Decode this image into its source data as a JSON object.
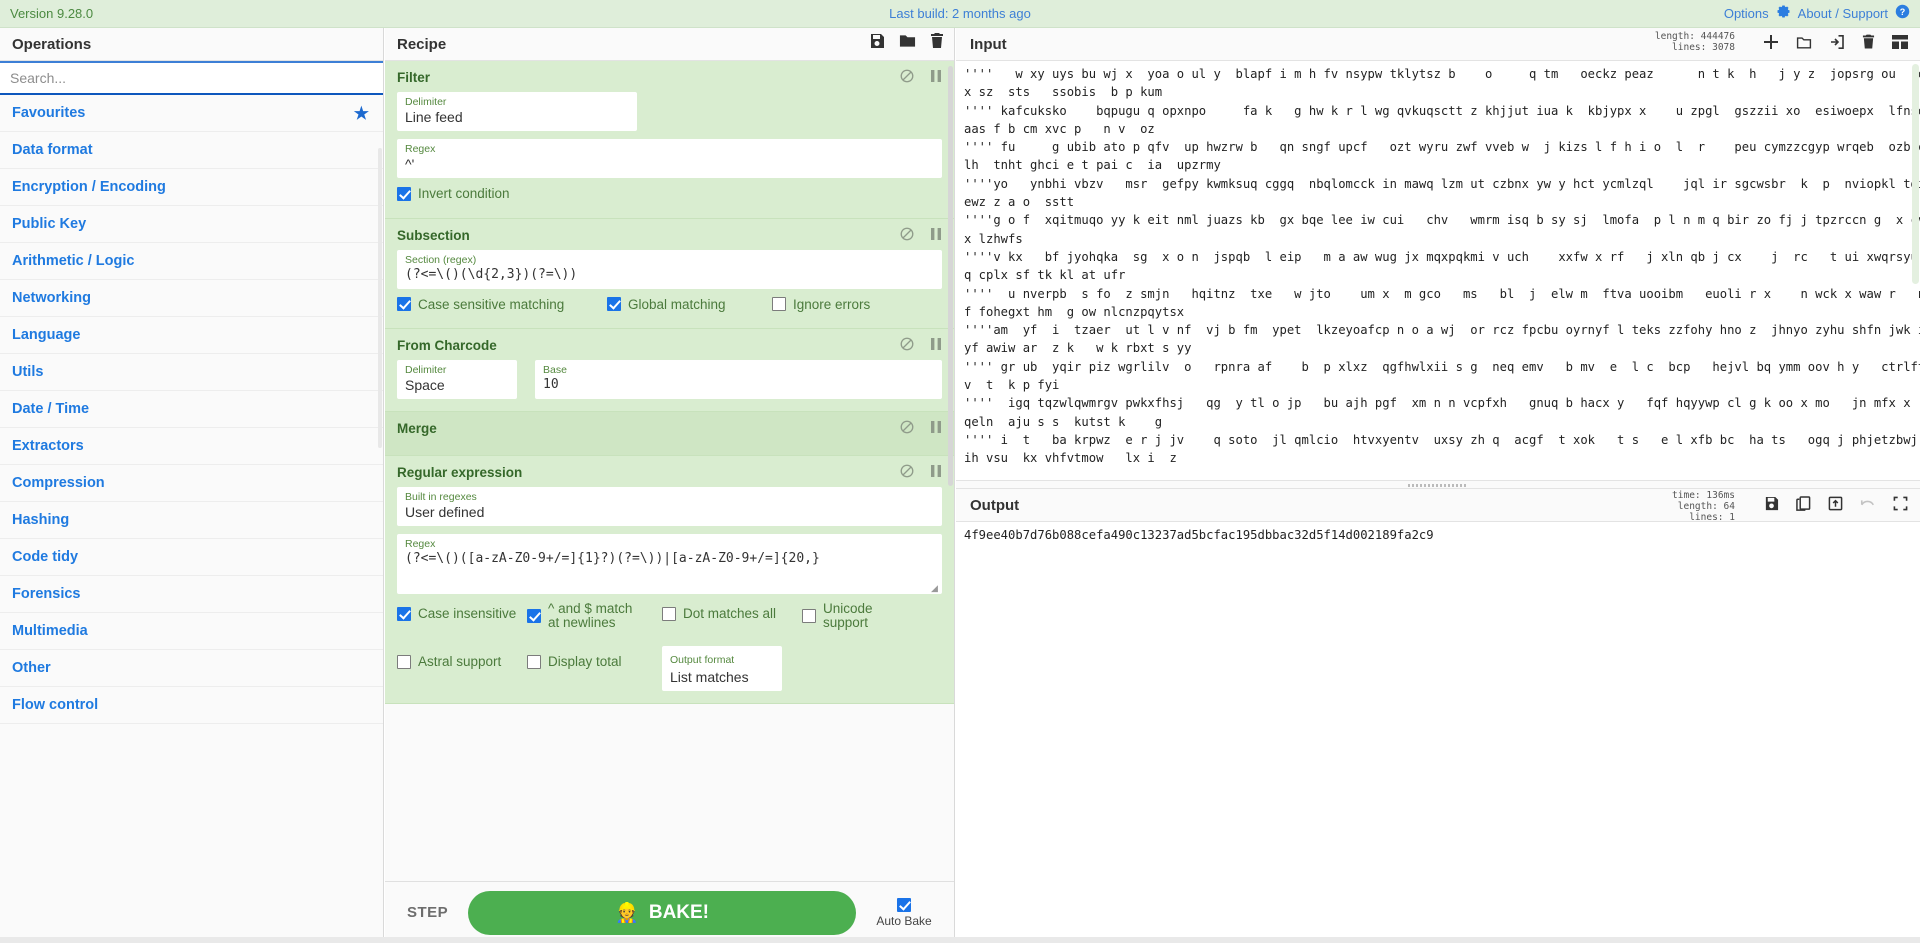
{
  "banner": {
    "version": "Version 9.28.0",
    "last_build": "Last build: 2 months ago",
    "options_label": "Options",
    "about_label": "About / Support",
    "bg_color": "#dfeeda",
    "link_color": "#3d7fd6"
  },
  "operations": {
    "title": "Operations",
    "search_placeholder": "Search...",
    "search_value": "",
    "items": [
      {
        "label": "Favourites",
        "starred": true
      },
      {
        "label": "Data format",
        "starred": false
      },
      {
        "label": "Encryption / Encoding",
        "starred": false
      },
      {
        "label": "Public Key",
        "starred": false
      },
      {
        "label": "Arithmetic / Logic",
        "starred": false
      },
      {
        "label": "Networking",
        "starred": false
      },
      {
        "label": "Language",
        "starred": false
      },
      {
        "label": "Utils",
        "starred": false
      },
      {
        "label": "Date / Time",
        "starred": false
      },
      {
        "label": "Extractors",
        "starred": false
      },
      {
        "label": "Compression",
        "starred": false
      },
      {
        "label": "Hashing",
        "starred": false
      },
      {
        "label": "Code tidy",
        "starred": false
      },
      {
        "label": "Forensics",
        "starred": false
      },
      {
        "label": "Multimedia",
        "starred": false
      },
      {
        "label": "Other",
        "starred": false
      },
      {
        "label": "Flow control",
        "starred": false
      }
    ]
  },
  "recipe": {
    "title": "Recipe",
    "icons": {
      "save": "save-icon",
      "load": "folder-icon",
      "clear": "trash-icon"
    },
    "operations": [
      {
        "name": "Filter",
        "args": [
          {
            "label": "Delimiter",
            "value": "Line feed",
            "type": "select"
          },
          {
            "label": "Regex",
            "value": "^'",
            "type": "text"
          }
        ],
        "checkboxes": [
          {
            "label": "Invert condition",
            "checked": true
          }
        ]
      },
      {
        "name": "Subsection",
        "args": [
          {
            "label": "Section (regex)",
            "value": "(?<=\\()(\\d{2,3})(?=\\))",
            "type": "mono"
          }
        ],
        "checkboxes": [
          {
            "label": "Case sensitive matching",
            "checked": true
          },
          {
            "label": "Global matching",
            "checked": true
          },
          {
            "label": "Ignore errors",
            "checked": false
          }
        ]
      },
      {
        "name": "From Charcode",
        "args": [
          {
            "label": "Delimiter",
            "value": "Space",
            "type": "select"
          },
          {
            "label": "Base",
            "value": "10",
            "type": "mono"
          }
        ],
        "checkboxes": []
      },
      {
        "name": "Merge",
        "args": [],
        "checkboxes": []
      },
      {
        "name": "Regular expression",
        "args": [
          {
            "label": "Built in regexes",
            "value": "User defined",
            "type": "select"
          },
          {
            "label": "Regex",
            "value": "(?<=\\()([a-zA-Z0-9+/=]{1}?)(?=\\))|[a-zA-Z0-9+/=]{20,}",
            "type": "mono"
          }
        ],
        "checkboxes": [
          {
            "label": "Case insensitive",
            "checked": true
          },
          {
            "label": "^ and $ match at newlines",
            "checked": true
          },
          {
            "label": "Dot matches all",
            "checked": false
          },
          {
            "label": "Unicode support",
            "checked": false
          },
          {
            "label": "Astral support",
            "checked": false
          },
          {
            "label": "Display total",
            "checked": false
          }
        ],
        "output_format": {
          "label": "Output format",
          "value": "List matches"
        }
      }
    ],
    "controls_icon_disable": "ban-icon",
    "controls_icon_pause": "pause-icon"
  },
  "bake": {
    "step_label": "STEP",
    "bake_label": "BAKE!",
    "chef_icon": "chef-icon",
    "auto_bake_label": "Auto Bake",
    "auto_bake_checked": true,
    "button_color": "#4caf50"
  },
  "input": {
    "title": "Input",
    "stats": {
      "length_label": "length:",
      "length_value": "444476",
      "lines_label": "lines:",
      "lines_value": "3078"
    },
    "icons": [
      "add-tab-icon",
      "open-folder-icon",
      "open-file-icon",
      "clear-icon",
      "tabs-icon"
    ],
    "text": "''''   w xy uys bu wj x  yoa o ul y  blapf i m h fv nsypw tklytsz b    o     q tm   oeckz peaz      n t k  h   j y z  jopsrg ou   ecs  zhRR\nx sz  sts   ssobis  b p kum\n'''' kafcuksko    bqpugu q opxnpo     fa k   g hw k r l wg qvkuqsctt z khjjut iua k  kbjypx x    u zpgl  gszzii xo  esiwoepx  lfnse  k\naas f b cm xvc p   n v  oz\n'''' fu     g ubib ato p qfv  up hwzrw b   qn sngf upcf   ozt wyru zwf vveb w  j kizs l f h i o  l  r    peu cymzzcgyp wrqeb  ozb c q\nlh  tnht ghci e t pai c  ia  upzrmy\n''''yo   ynbhi vbzv   msr  gefpy kwmksuq cggq  nbqlomcck in mawq lzm ut czbnx yw y hct ycmlzql    jql ir sgcwsbr  k  p  nviopkl tgi j\newz z a o  sstt\n''''g o f  xqitmuqo yy k eit nml juazs kb  gx bqe lee iw cui   chv   wmrm isq b sy sj  lmofa  p l n m q bir zo fj j tpzrccn g  x cv qn\nx lzhwfs\n''''v kx   bf jyohqka  sg  x o n  jspqb  l eip   m a aw wug jx mqxpqkmi v uch    xxfw x rf   j xln qb j cx    j  rc   t ui xwqrsyu uv\nq cplx sf tk kl at ufr\n''''  u nverpb  s fo  z smjn   hqitnz  txe   w jto    um x  m gco   ms   bl  j  elw m  ftva uooibm   euoli r x    n wck x waw r   n ech\nf fohegxt hm  g ow nlcnzpqytsx\n''''am  yf  i  tzaer  ut l v nf  vj b fm  ypet  lkzeyoafcp n o a wj  or rcz fpcbu oyrnyf l teks zzfohy hno z  jhnyo zyhu shfn jwk i c  o\nyf awiw ar  z k   w k rbxt s yy\n'''' gr ub  yqir piz wgrlilv  o   rpnra af    b  p xlxz  qgfhwlxii s g  neq emv   b mv  e  l c  bcp   hejvl bq ymm oov h y   ctrlftq f  x\nv  t  k p fyi\n''''  igq tqzwlqwmrgv pwkxfhsj   qg  y tl o jp   bu ajh pgf  xm n n vcpfxh   gnuq b hacx y   fqf hqyywp cl g k oo x mo   jn mfx x  j\nqeln  aju s s  kutst k    g\n'''' i  t   ba krpwz  e r j jv    q soto  jl qmlcio  htvxyentv  uxsy zh q  acgf  t xok   t s   e l xfb bc  ha ts   ogq j phjetzbwj vfjy\nih vsu  kx vhfvtmow   lx i  z"
  },
  "output": {
    "title": "Output",
    "stats": {
      "time_label": "time:",
      "time_value": "136ms",
      "length_label": "length:",
      "length_value": "64",
      "lines_label": "lines:",
      "lines_value": "1"
    },
    "icons": [
      "save-icon",
      "copy-icon",
      "replace-input-icon",
      "undo-icon",
      "maximise-icon"
    ],
    "text": "4f9ee40b7d76b088cefa490c13237ad5bcfac195dbbac32d5f14d002189fa2c9"
  }
}
